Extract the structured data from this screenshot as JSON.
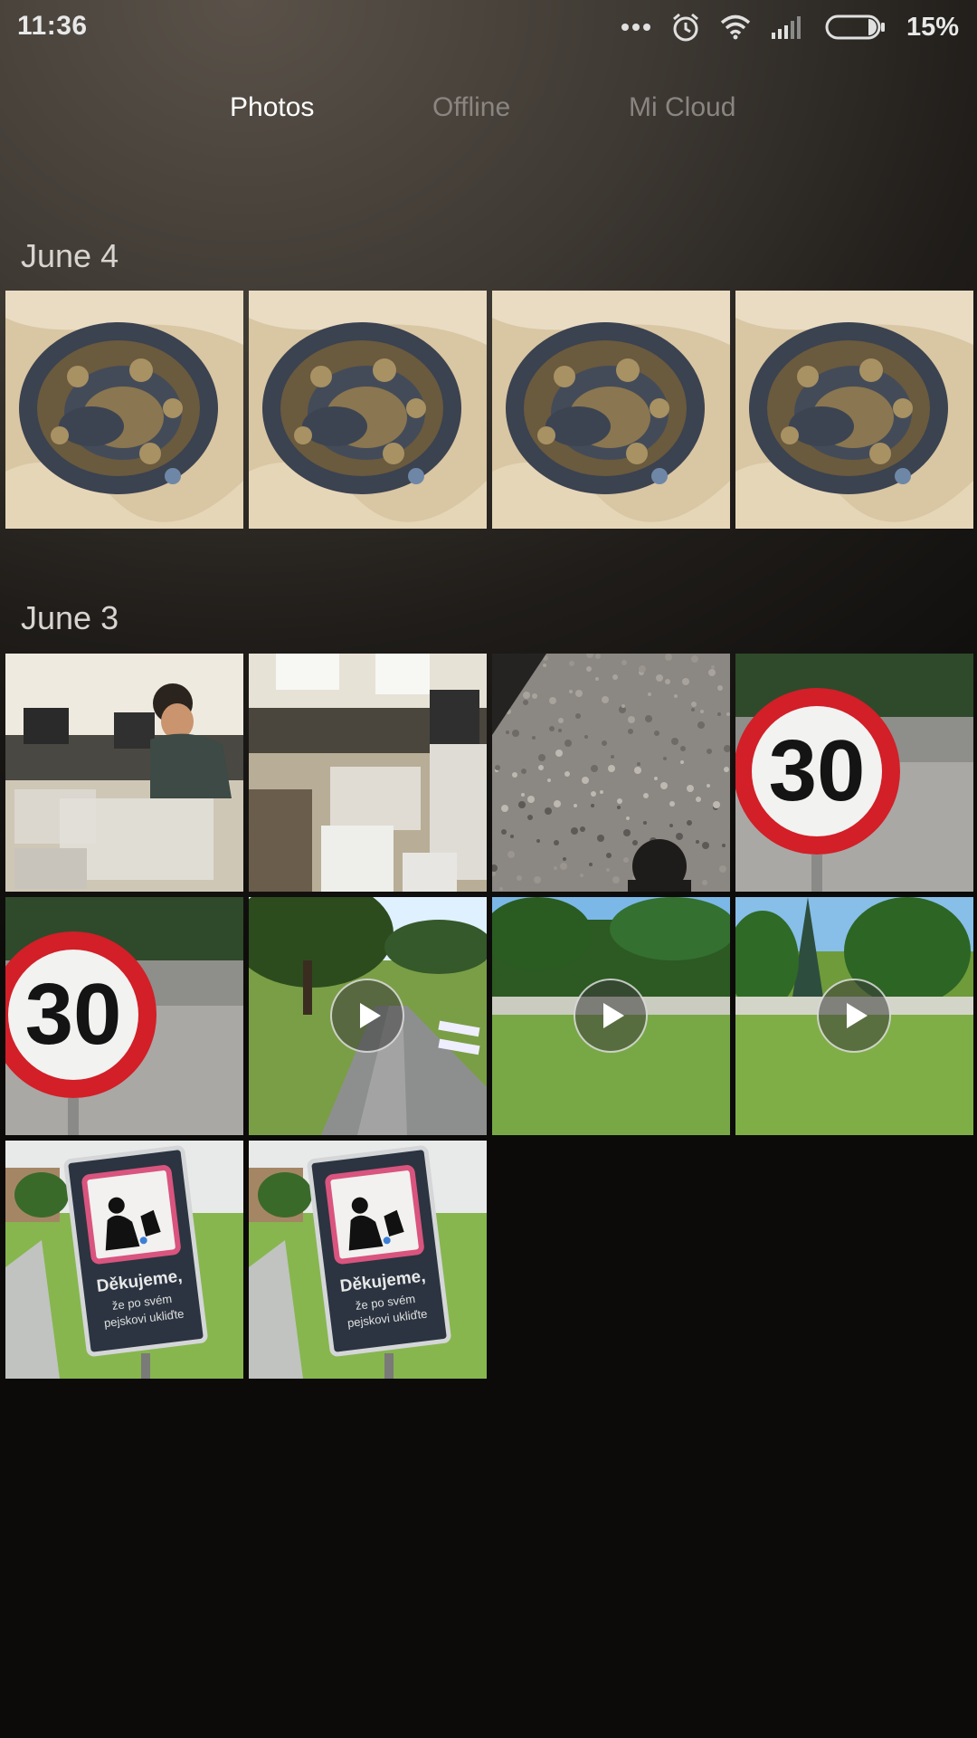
{
  "status_bar": {
    "time": "11:36",
    "battery_percent": "15%",
    "icons": [
      "more-dots-icon",
      "alarm-icon",
      "wifi-icon",
      "signal-icon",
      "battery-icon"
    ]
  },
  "tabs": [
    {
      "label": "Photos",
      "active": true
    },
    {
      "label": "Offline",
      "active": false
    },
    {
      "label": "Mi Cloud",
      "active": false
    }
  ],
  "sections": [
    {
      "date": "June 4",
      "items": [
        {
          "subject": "snake",
          "is_video": false
        },
        {
          "subject": "snake",
          "is_video": false
        },
        {
          "subject": "snake",
          "is_video": false
        },
        {
          "subject": "snake",
          "is_video": false
        }
      ]
    },
    {
      "date": "June 3",
      "items": [
        {
          "subject": "lab-person",
          "is_video": false
        },
        {
          "subject": "lab-room",
          "is_video": false
        },
        {
          "subject": "gravel",
          "is_video": false
        },
        {
          "subject": "speed-sign",
          "is_video": false
        },
        {
          "subject": "speed-sign",
          "is_video": false
        },
        {
          "subject": "street-park",
          "is_video": true
        },
        {
          "subject": "park-lawn",
          "is_video": true
        },
        {
          "subject": "park-trees",
          "is_video": true
        },
        {
          "subject": "dog-sign",
          "is_video": false
        },
        {
          "subject": "dog-sign",
          "is_video": false
        }
      ]
    }
  ],
  "sign_text": {
    "speed_limit": "30",
    "dog_sign_title": "Děkujeme,",
    "dog_sign_line1": "že po svém",
    "dog_sign_line2": "pejskovi ukliďte"
  },
  "colors": {
    "tab_active": "#ffffff",
    "tab_inactive": "#8a8580",
    "date_label": "#d8d4d0"
  }
}
